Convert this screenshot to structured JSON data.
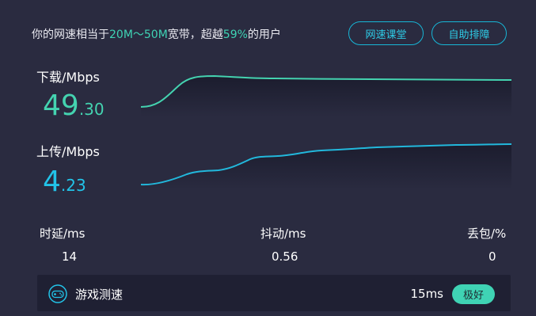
{
  "summary": {
    "prefix": "你的网速相当于",
    "range": "20M～50M",
    "middle": "宽带，超越",
    "percent": "59%",
    "suffix": "的用户"
  },
  "buttons": {
    "course": "网速课堂",
    "help": "自助排障"
  },
  "download": {
    "label": "下载/Mbps",
    "int_part": "49",
    "dec_part": ".30"
  },
  "upload": {
    "label": "上传/Mbps",
    "int_part": "4",
    "dec_part": ".23"
  },
  "stats": {
    "latency": {
      "label": "时延/ms",
      "value": "14"
    },
    "jitter": {
      "label": "抖动/ms",
      "value": "0.56"
    },
    "loss": {
      "label": "丢包/%",
      "value": "0"
    }
  },
  "game": {
    "title": "游戏测速",
    "ms": "15ms",
    "badge": "极好",
    "icon": "gamepad-icon"
  },
  "colors": {
    "background": "#2a2b40",
    "download_accent": "#44d3b0",
    "upload_accent": "#22c3e8",
    "highlight": "#3fd3b4"
  }
}
